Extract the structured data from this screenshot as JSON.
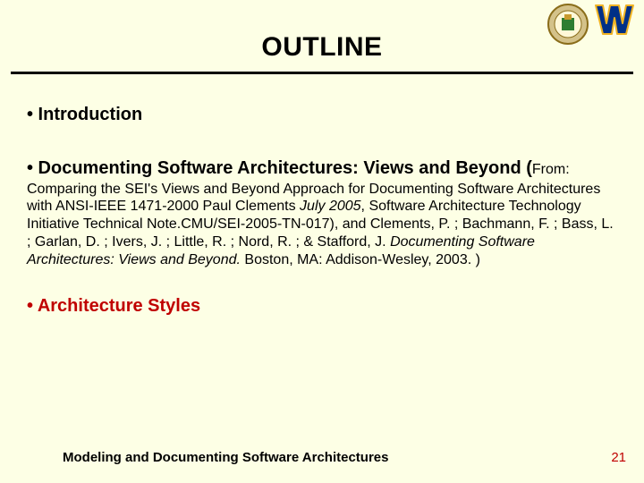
{
  "title": "OUTLINE",
  "bullets": {
    "intro": "• Introduction",
    "doc_lead": "• Documenting Software Architectures: Views and Beyond (",
    "doc_body_a": "From: Comparing the SEI's Views and Beyond Approach for Documenting Software Architectures with ANSI-IEEE 1471-2000 Paul Clements ",
    "doc_body_italic1": "July 2005",
    "doc_body_b": ", Software Architecture Technology Initiative Technical Note.CMU/SEI-2005-TN-017), and Clements, P. ; Bachmann, F. ; Bass, L. ; Garlan, D. ; Ivers, J. ; Little, R. ; Nord, R. ; & Stafford, J. ",
    "doc_body_italic2": "Documenting Software Architectures: Views and Beyond.",
    "doc_body_c": " Boston, MA: Addison-Wesley, 2003. )",
    "arch": "• Architecture Styles"
  },
  "footer": {
    "text": "Modeling and Documenting Software Architectures",
    "page": "21"
  }
}
